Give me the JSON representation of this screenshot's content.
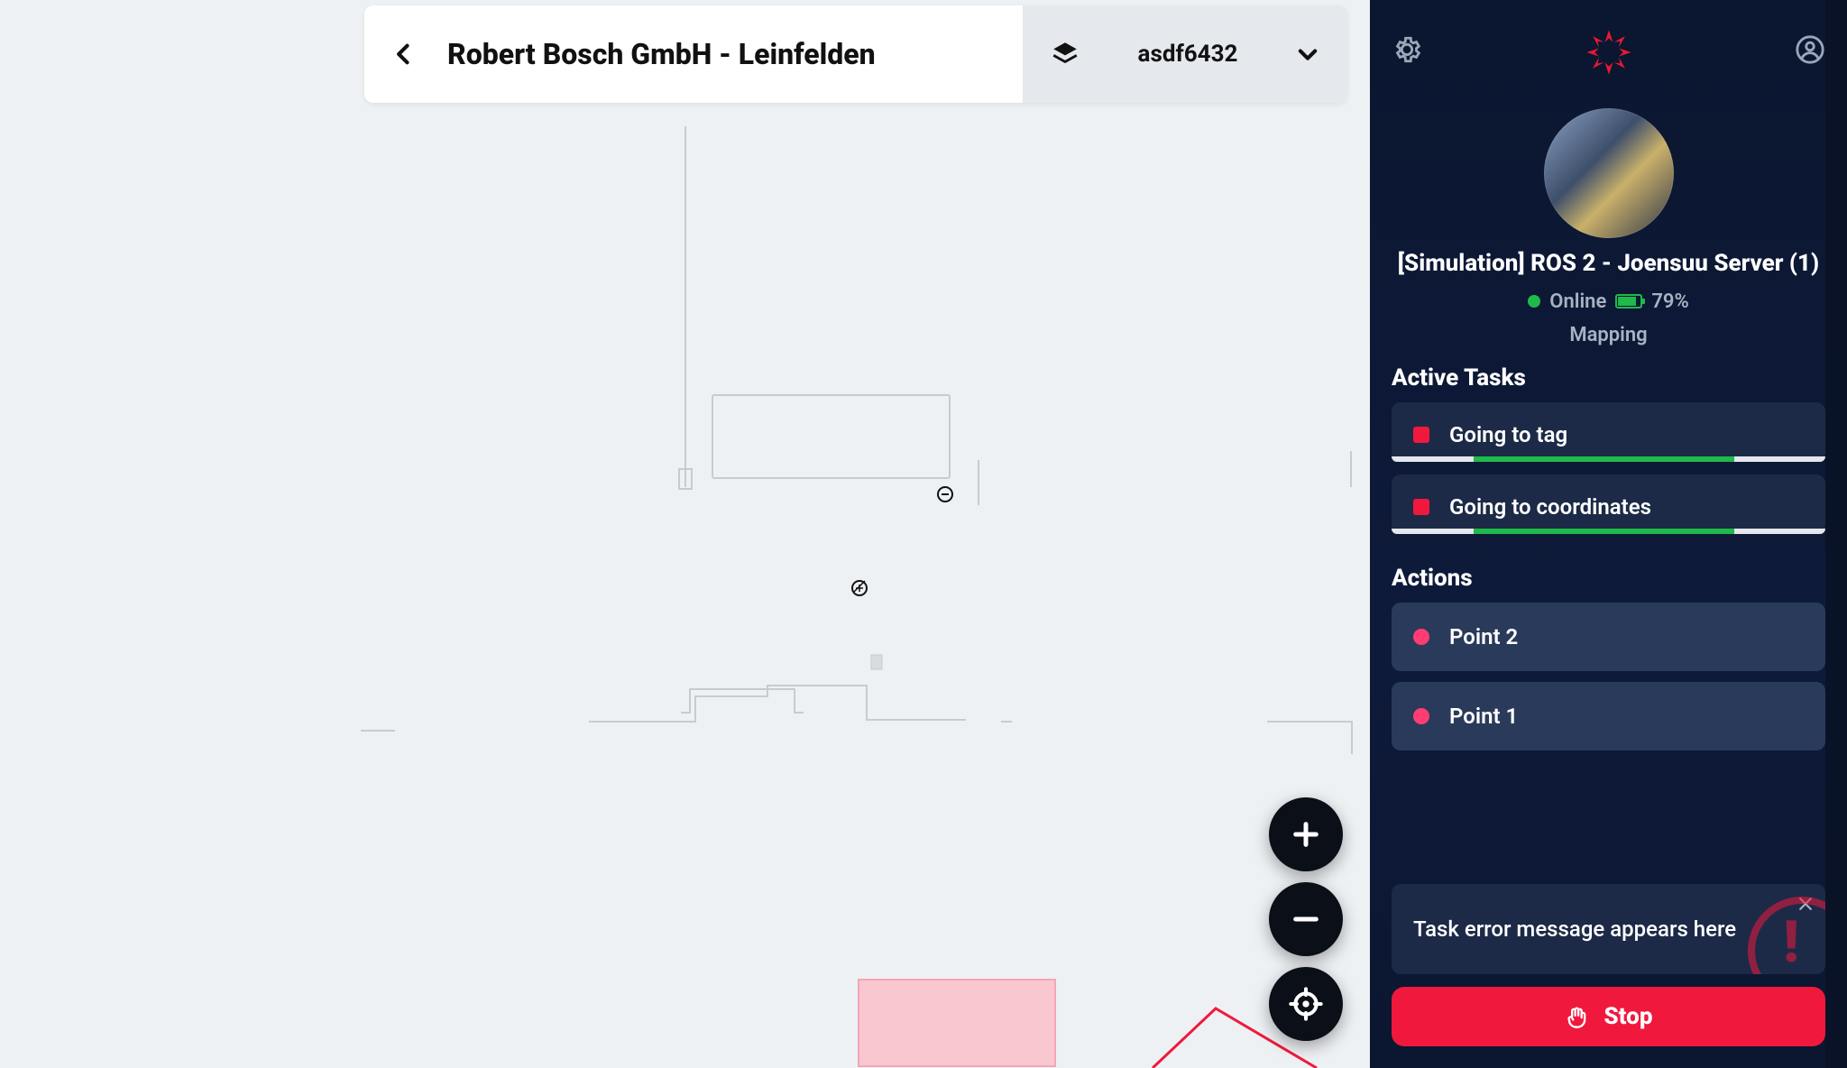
{
  "header": {
    "title": "Robert Bosch GmbH - Leinfelden",
    "map_dropdown": {
      "selected": "asdf6432"
    }
  },
  "sidebar": {
    "robot": {
      "name": "[Simulation] ROS 2 - Joensuu Server (1)",
      "status": "Online",
      "battery_pct": "79%",
      "mode": "Mapping"
    },
    "sections": {
      "active_tasks_title": "Active Tasks",
      "actions_title": "Actions"
    },
    "tasks": [
      {
        "label": "Going to tag",
        "progress": 60
      },
      {
        "label": "Going to coordinates",
        "progress": 60
      }
    ],
    "actions": [
      {
        "label": "Point 2"
      },
      {
        "label": "Point 1"
      }
    ],
    "error": {
      "message": "Task error message appears here"
    },
    "stop_label": "Stop"
  },
  "colors": {
    "accent_red": "#f0193d",
    "accent_green": "#1fba4a",
    "sidebar_bg": "#0b1630"
  },
  "icons": {
    "back": "chevron-left-icon",
    "layers": "layers-icon",
    "dropdown": "chevron-down-icon",
    "gear": "gear-icon",
    "profile": "profile-icon",
    "logo": "app-logo-icon",
    "zoom_in": "plus-icon",
    "zoom_out": "minus-icon",
    "center": "crosshair-icon",
    "stop_hand": "hand-icon",
    "close": "close-icon",
    "alert": "alert-icon"
  }
}
